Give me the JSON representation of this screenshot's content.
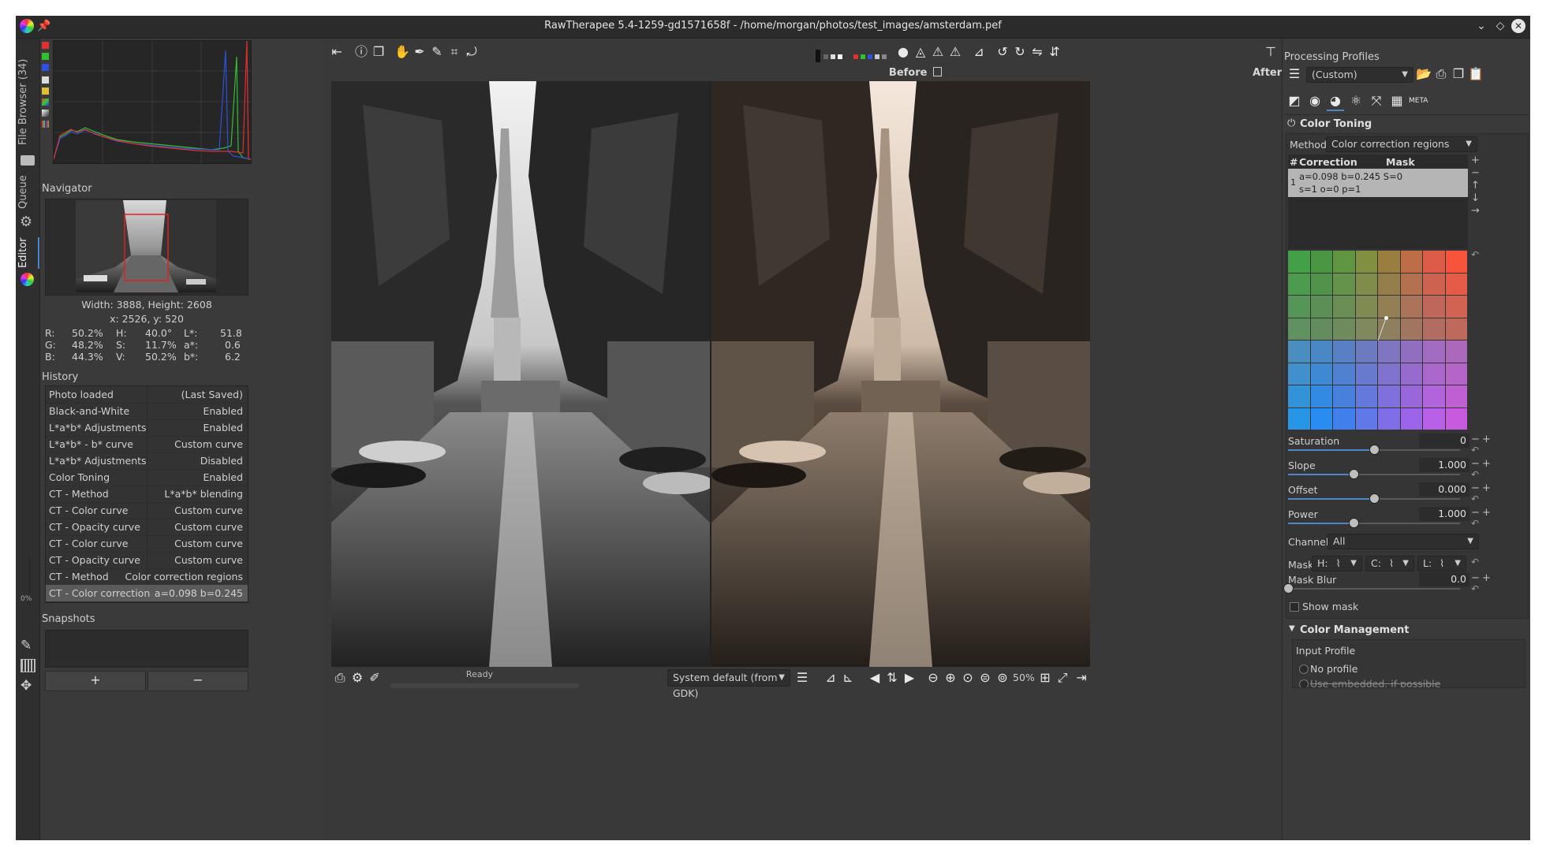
{
  "window": {
    "title": "RawTherapee 5.4-1259-gd1571658f - /home/morgan/photos/test_images/amsterdam.pef"
  },
  "vtabs": {
    "file_browser": "File Browser (34)",
    "queue": "Queue",
    "editor": "Editor",
    "progress": "0%"
  },
  "navigator": {
    "title": "Navigator",
    "dimensions": "Width: 3888, Height: 2608",
    "coords": "x: 2526, y: 520",
    "r": {
      "label": "R:",
      "value": "50.2%"
    },
    "g": {
      "label": "G:",
      "value": "48.2%"
    },
    "b": {
      "label": "B:",
      "value": "44.3%"
    },
    "h": {
      "label": "H:",
      "value": "40.0°"
    },
    "s": {
      "label": "S:",
      "value": "11.7%"
    },
    "v": {
      "label": "V:",
      "value": "50.2%"
    },
    "l": {
      "label": "L*:",
      "value": "51.8"
    },
    "a": {
      "label": "a*:",
      "value": "0.6"
    },
    "bb": {
      "label": "b*:",
      "value": "6.2"
    }
  },
  "history": {
    "title": "History",
    "rows": [
      {
        "action": "Photo loaded",
        "value": "(Last Saved)"
      },
      {
        "action": "Black-and-White",
        "value": "Enabled"
      },
      {
        "action": "L*a*b* Adjustments",
        "value": "Enabled"
      },
      {
        "action": "L*a*b* - b* curve",
        "value": "Custom curve"
      },
      {
        "action": "L*a*b* Adjustments",
        "value": "Disabled"
      },
      {
        "action": "Color Toning",
        "value": "Enabled"
      },
      {
        "action": "CT - Method",
        "value": "L*a*b* blending"
      },
      {
        "action": "CT - Color curve",
        "value": "Custom curve"
      },
      {
        "action": "CT - Opacity curve",
        "value": "Custom curve"
      },
      {
        "action": "CT - Color curve",
        "value": "Custom curve"
      },
      {
        "action": "CT - Opacity curve",
        "value": "Custom curve"
      },
      {
        "action": "CT - Method",
        "value": "Color correction regions"
      },
      {
        "action": "CT - Color correction",
        "value": "a=0.098 b=0.245"
      }
    ]
  },
  "snapshots": {
    "title": "Snapshots",
    "add": "+",
    "remove": "−"
  },
  "viewer": {
    "before_label": "Before",
    "after_label": "After",
    "status": "Ready",
    "monitor_profile": "System default (from GDK)",
    "zoom": "50%"
  },
  "processing_profiles": {
    "title": "Processing Profiles",
    "selected": "(Custom)"
  },
  "color_toning": {
    "title": "Color Toning",
    "method_label": "Method",
    "method_value": "Color correction regions",
    "list_header_num": "#",
    "list_header_correction": "Correction",
    "list_header_mask": "Mask",
    "entry_num": "1",
    "entry_line1": "a=0.098 b=0.245 S=0",
    "entry_line2": "s=1 o=0 p=1",
    "saturation": {
      "label": "Saturation",
      "value": "0",
      "fraction": 0.5
    },
    "slope": {
      "label": "Slope",
      "value": "1.000",
      "fraction": 0.38
    },
    "offset": {
      "label": "Offset",
      "value": "0.000",
      "fraction": 0.5
    },
    "power": {
      "label": "Power",
      "value": "1.000",
      "fraction": 0.38
    },
    "channel_label": "Channel:",
    "channel_value": "All",
    "mask_label": "Mask:",
    "mask_h": "H:",
    "mask_c": "C:",
    "mask_l": "L:",
    "mask_blur": {
      "label": "Mask Blur",
      "value": "0.0",
      "fraction": 0.0
    },
    "show_mask": "Show mask"
  },
  "color_management": {
    "title": "Color Management",
    "input_profile_label": "Input Profile",
    "no_profile": "No profile",
    "use_embedded": "Use embedded, if possible"
  },
  "colors": {
    "accent": "#4e86c9",
    "panel_bg": "#3a3a3a",
    "histogram_red": "#e03030",
    "histogram_green": "#30c030",
    "histogram_blue": "#3050e0"
  }
}
